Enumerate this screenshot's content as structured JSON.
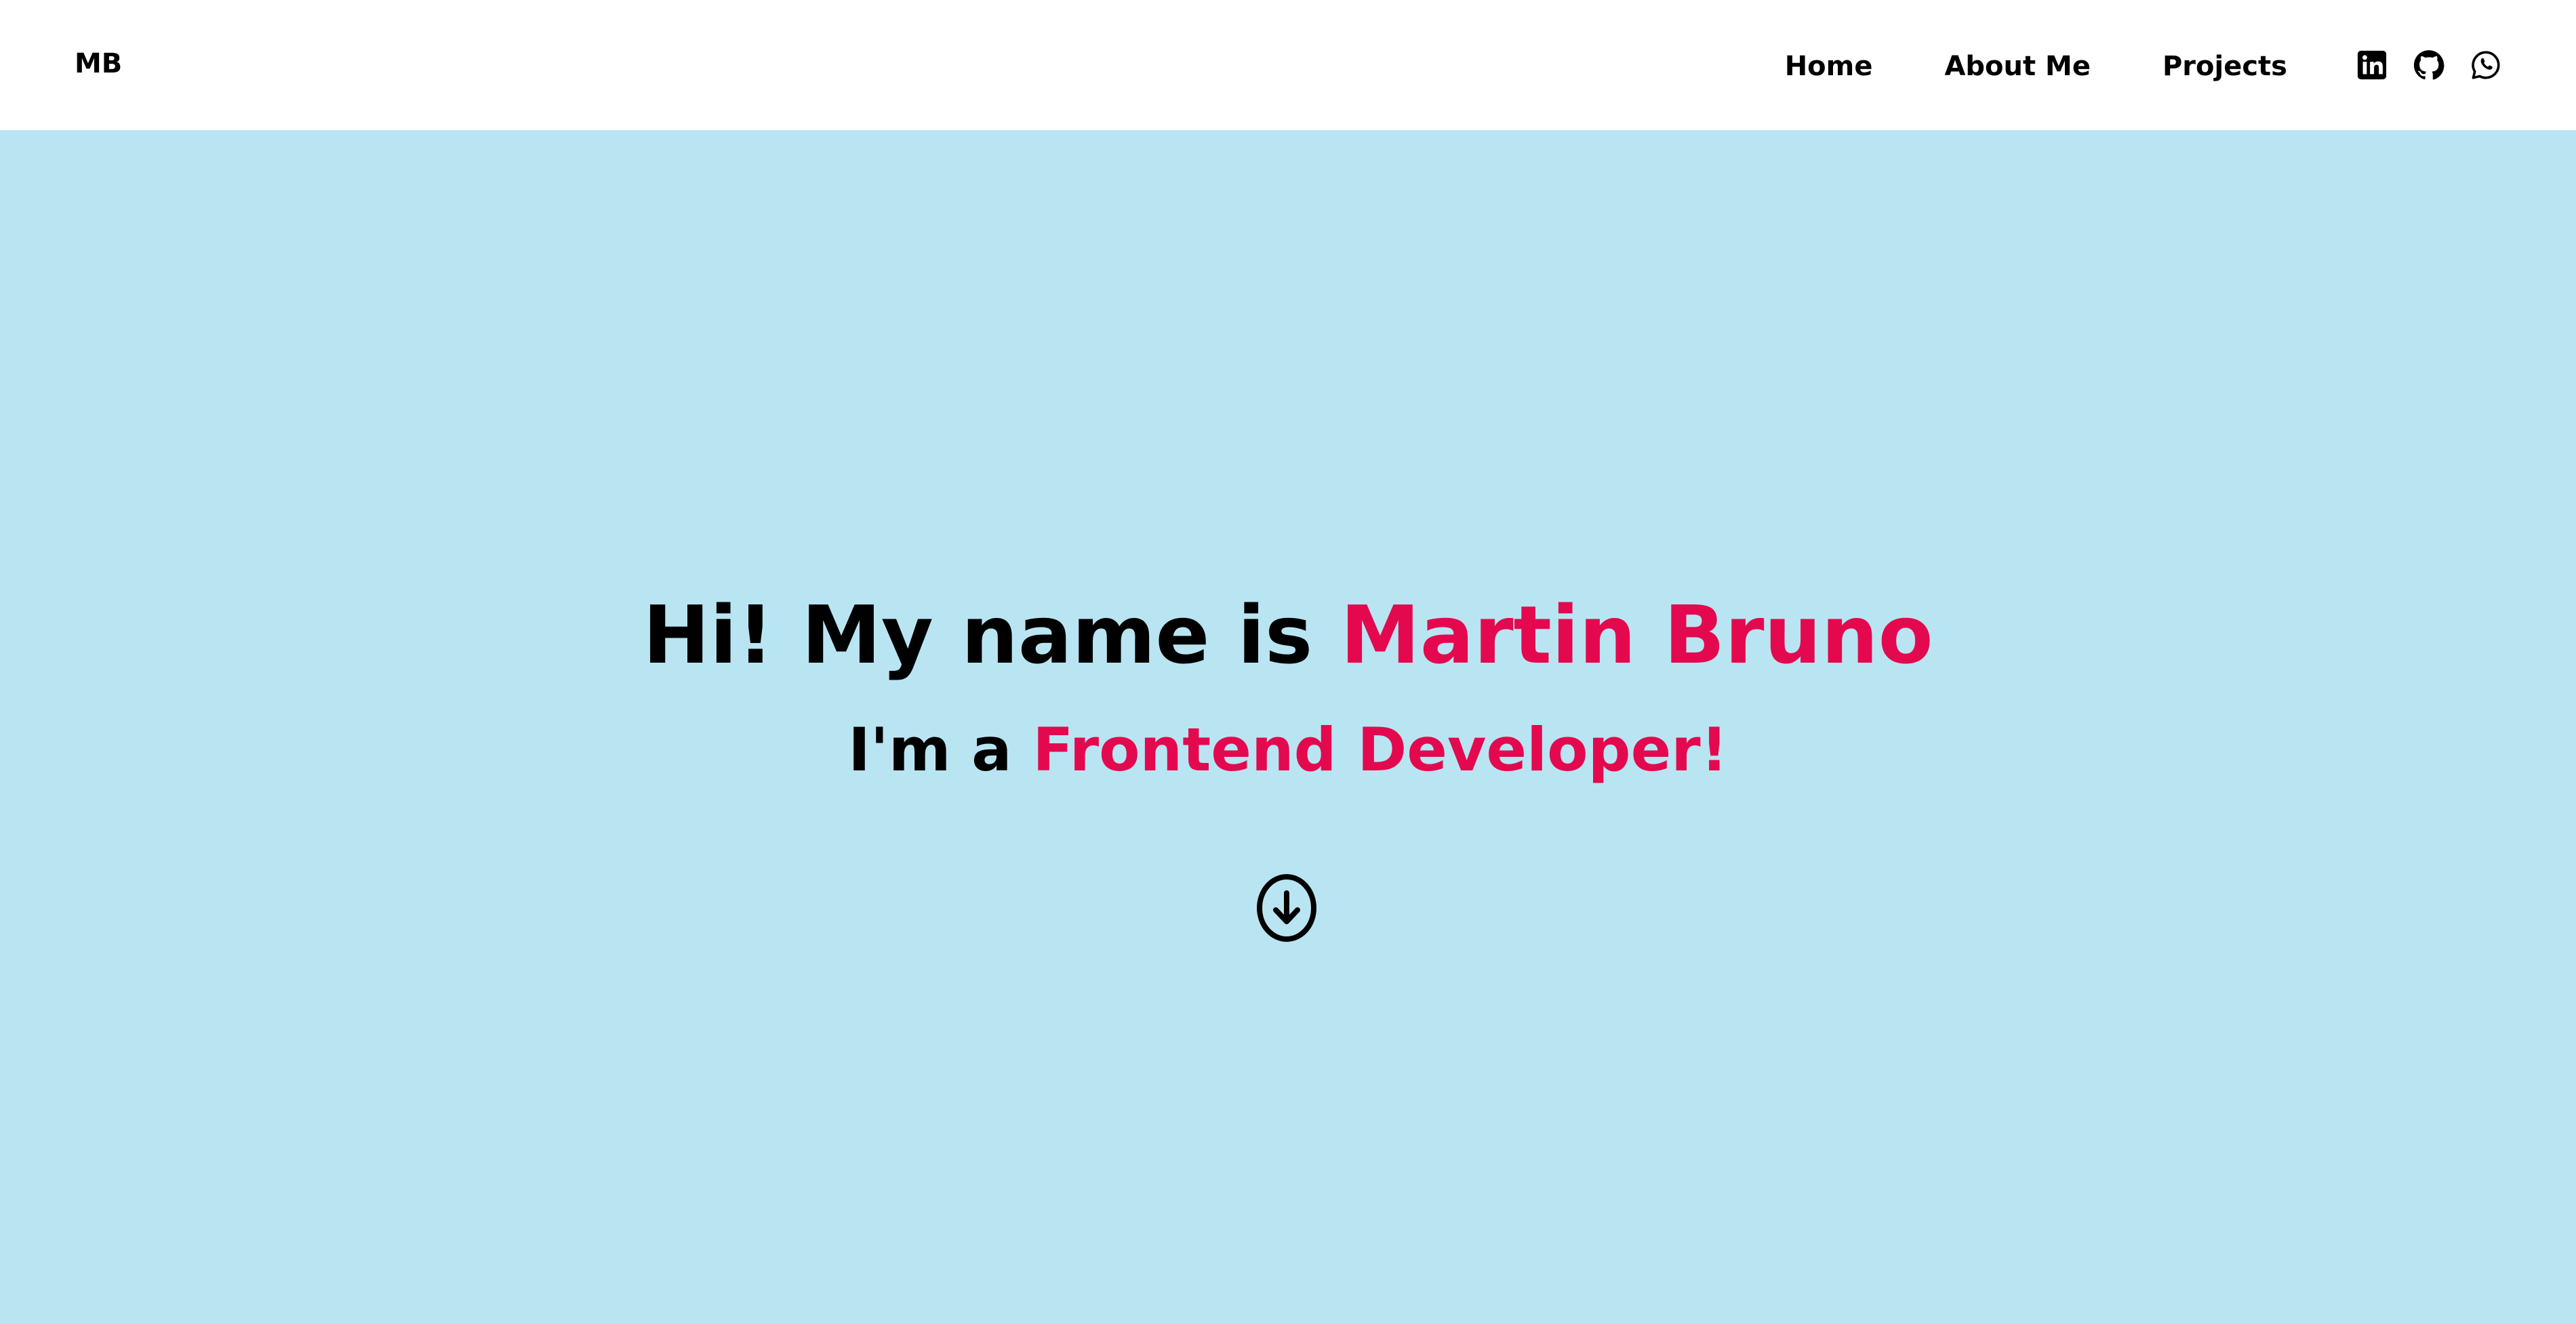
{
  "nav": {
    "logo": "MB",
    "links": [
      {
        "label": "Home"
      },
      {
        "label": "About Me"
      },
      {
        "label": "Projects"
      }
    ],
    "social": [
      {
        "icon": "linkedin-icon"
      },
      {
        "icon": "github-icon"
      },
      {
        "icon": "whatsapp-icon"
      }
    ]
  },
  "hero": {
    "greeting": "Hi! My name is ",
    "name": "Martin Bruno",
    "role_prefix": "I'm a ",
    "role": "Frontend Developer!",
    "scroll_icon": "arrow-down-circle-icon"
  },
  "colors": {
    "hero_background": "#b9e5f3",
    "accent": "#e4094f",
    "navbar_background": "#ffffff",
    "text": "#000000"
  }
}
